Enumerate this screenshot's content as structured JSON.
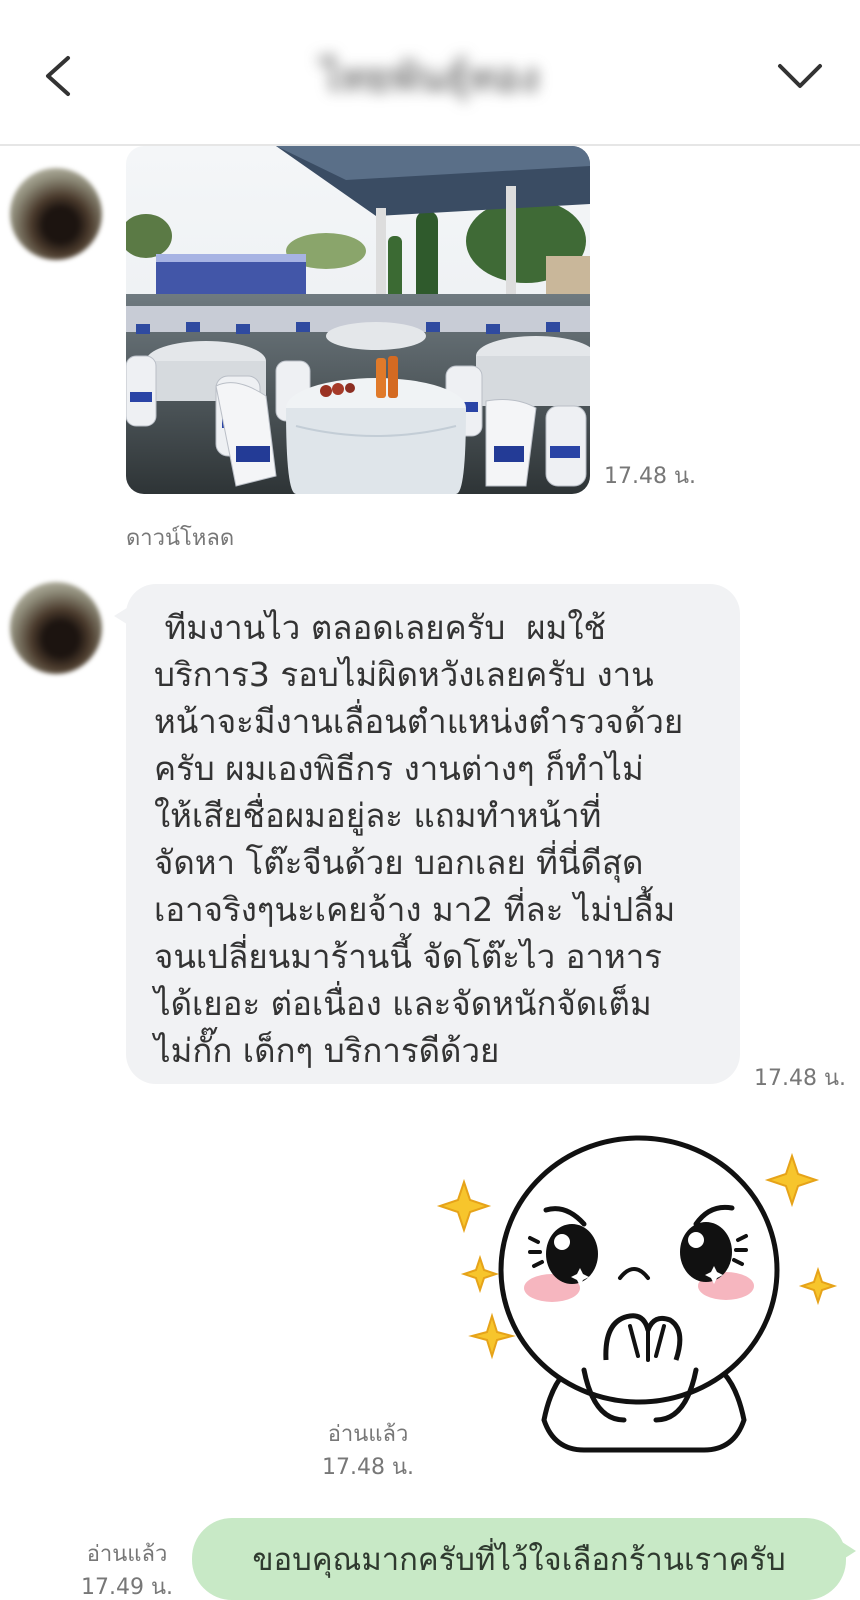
{
  "header": {
    "title": "ไทยพันธุ์ทอง",
    "back_icon": "chevron-left-icon",
    "menu_icon": "chevron-down-icon"
  },
  "messages": [
    {
      "type": "image",
      "sender": "other",
      "image_subject": "banquet hall with round tables and white chairs",
      "time": "17.48 น.",
      "download_label": "ดาวน์โหลด"
    },
    {
      "type": "text",
      "sender": "other",
      "text": " ทีมงานไว ตลอดเลยครับ  ผมใช้\nบริการ3 รอบไม่ผิดหวังเลยครับ งาน\nหน้าจะมีงานเลื่อนตำแหน่งตำรวจด้วย\nครับ ผมเองพิธีกร งานต่างๆ ก็ทำไม่\nให้เสียชื่อผมอยู่ละ แถมทำหน้าที่\nจัดหา โต๊ะจีนด้วย บอกเลย ที่นี่ดีสุด\nเอาจริงๆนะเคยจ้าง มา2 ที่ละ ไม่ปลื้ม\nจนเปลี่ยนมาร้านนี้ จัดโต๊ะไว อาหาร\nได้เยอะ ต่อเนื่อง และจัดหนักจัดเต็ม\nไม่กั๊ก เด็กๆ บริการดีด้วย",
      "time": "17.48 น."
    },
    {
      "type": "sticker",
      "sender": "me",
      "sticker_name": "touched-moon-sticker",
      "read_label": "อ่านแล้ว",
      "time": "17.48 น."
    },
    {
      "type": "text",
      "sender": "me",
      "text": "ขอบคุณมากครับที่ไว้ใจเลือกร้านเราครับ",
      "read_label": "อ่านแล้ว",
      "time": "17.49 น."
    }
  ],
  "colors": {
    "incoming_bubble": "#f1f2f4",
    "outgoing_bubble": "#c8e9c6",
    "timestamp": "#777777"
  }
}
